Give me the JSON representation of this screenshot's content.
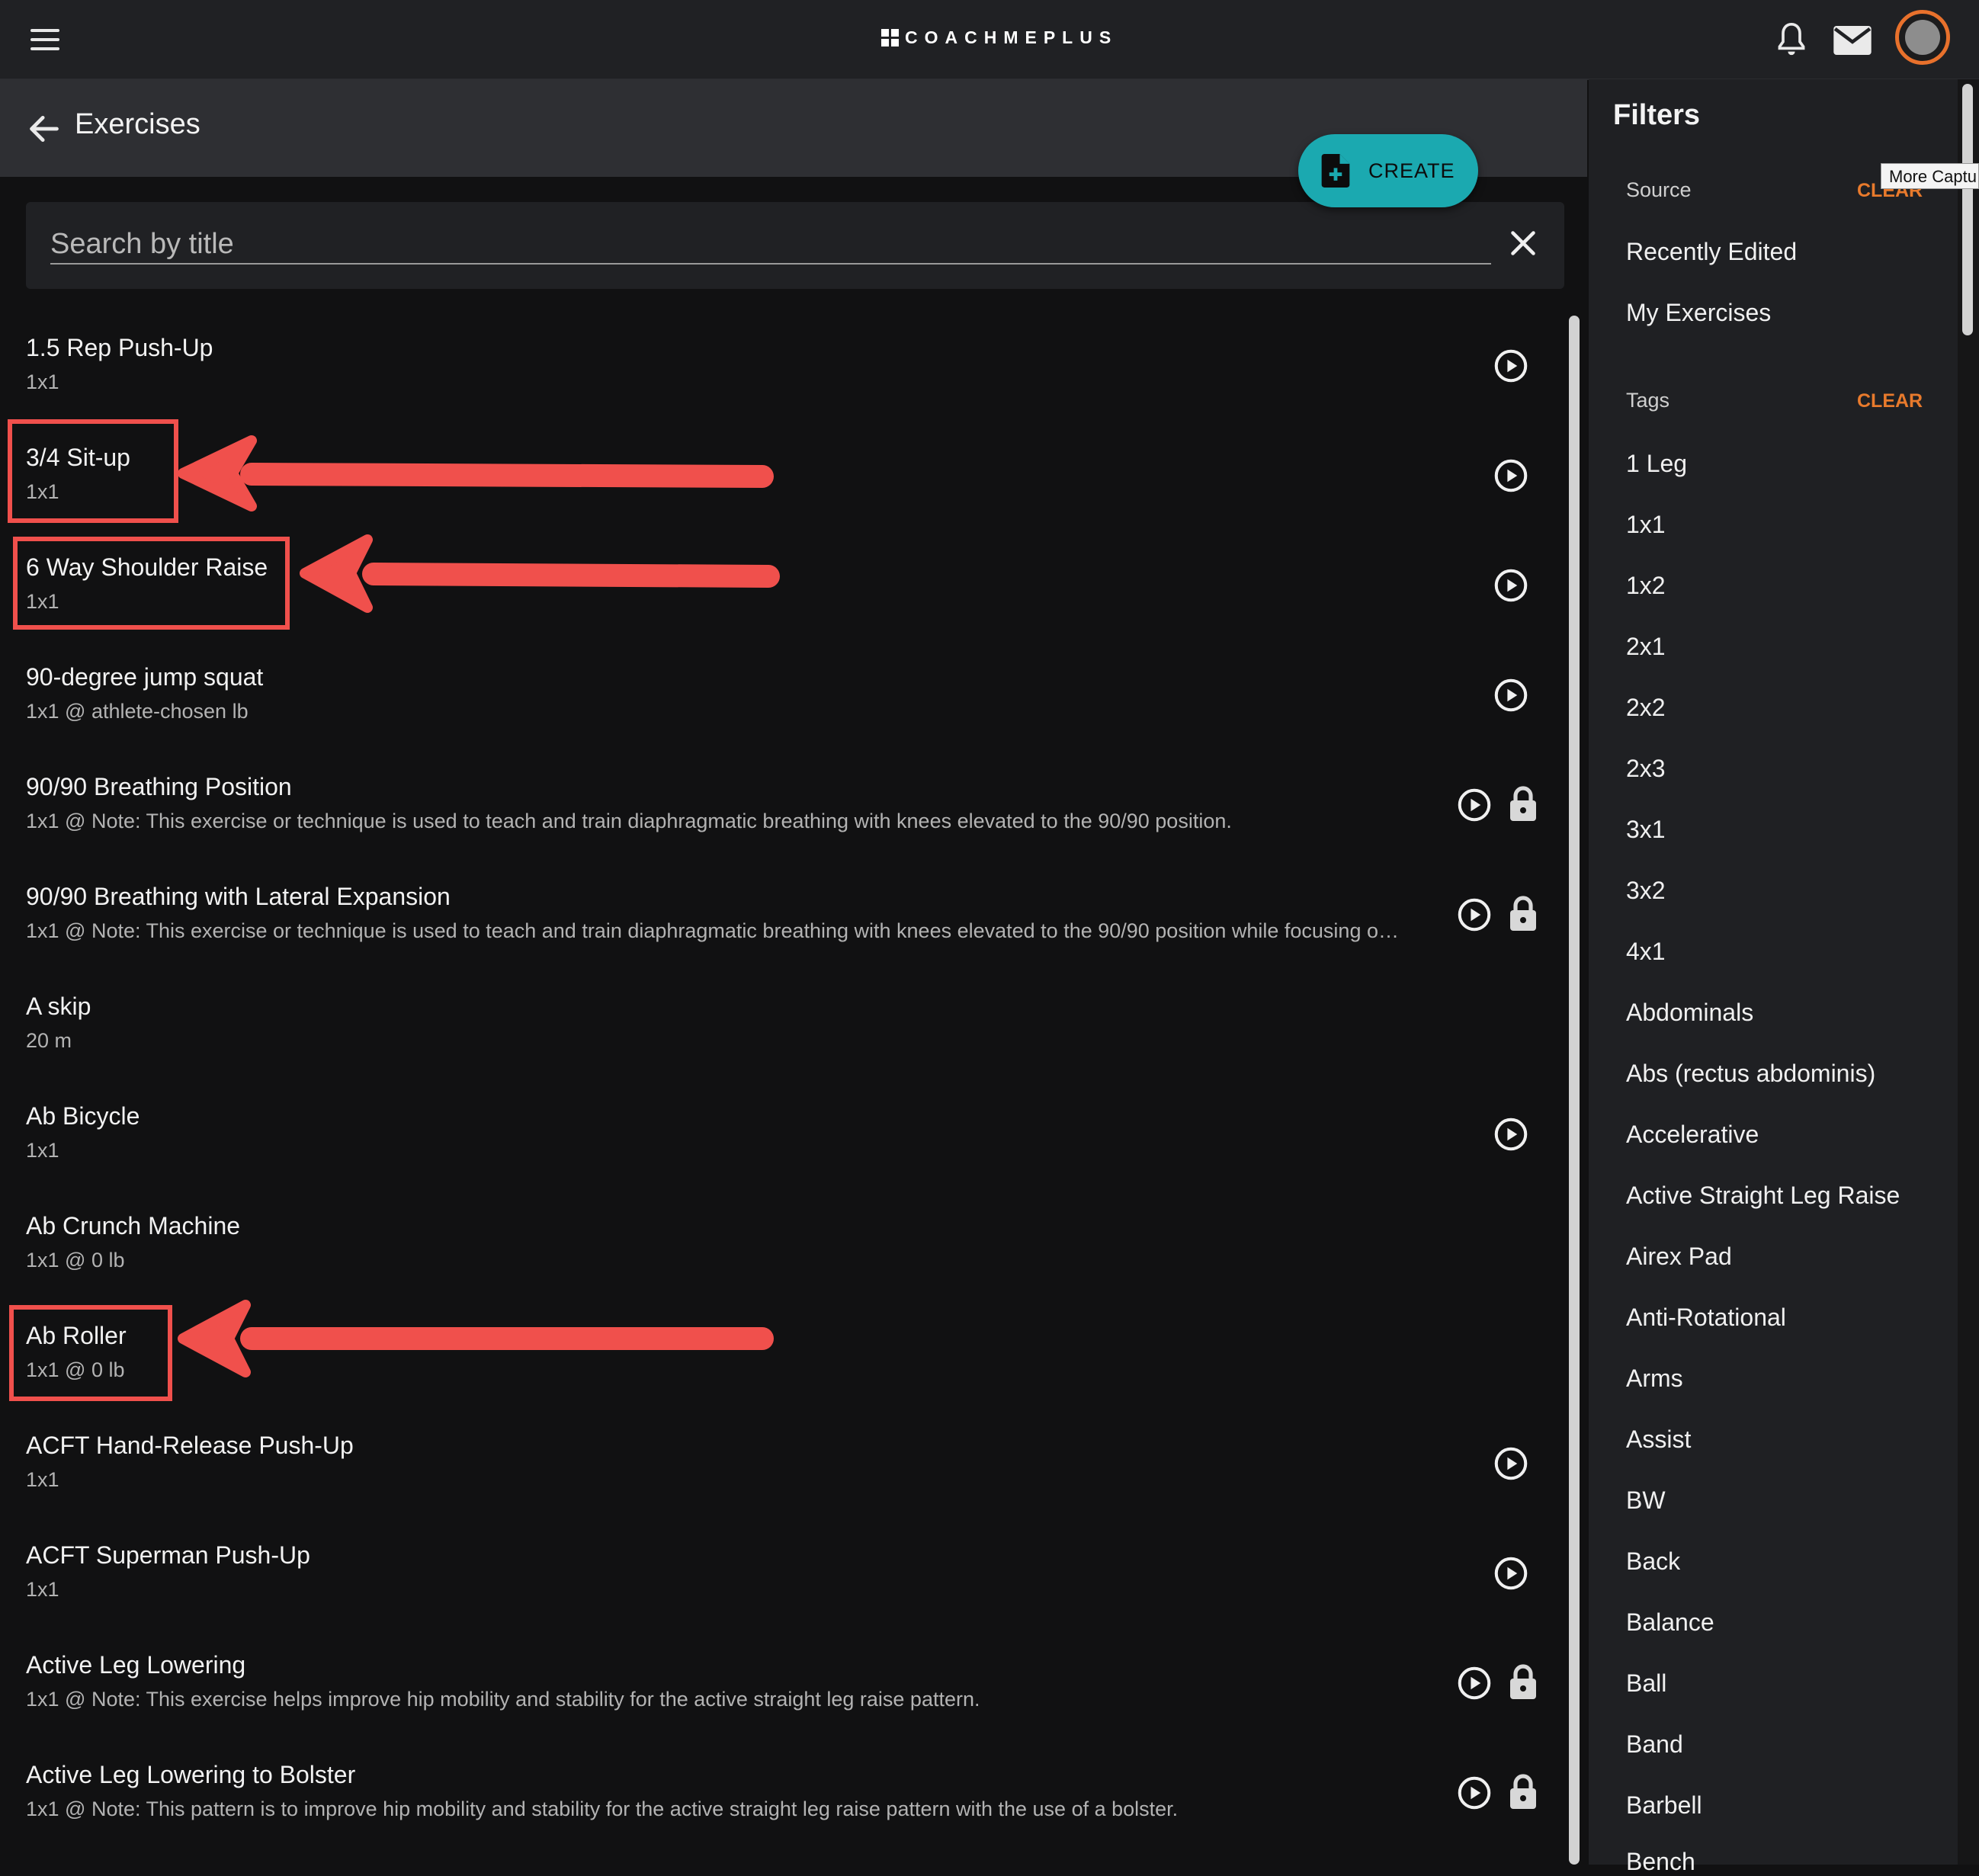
{
  "app": {
    "logo_text": "COACHMEPLUS"
  },
  "header": {
    "title": "Exercises",
    "create_label": "CREATE"
  },
  "search": {
    "placeholder": "Search by title",
    "value": ""
  },
  "exercises": [
    {
      "name": "1.5 Rep Push-Up",
      "detail": "1x1",
      "video": true,
      "locked": false
    },
    {
      "name": "3/4 Sit-up",
      "detail": "1x1",
      "video": true,
      "locked": false
    },
    {
      "name": "6 Way Shoulder Raise",
      "detail": "1x1",
      "video": true,
      "locked": false
    },
    {
      "name": "90-degree jump squat",
      "detail": "1x1 @ athlete-chosen lb",
      "video": true,
      "locked": false
    },
    {
      "name": "90/90 Breathing Position",
      "detail": "1x1 @ Note: This exercise or technique is used to teach and train diaphragmatic breathing with knees elevated to the 90/90 position.",
      "video": true,
      "locked": true
    },
    {
      "name": "90/90 Breathing with Lateral Expansion",
      "detail": "1x1 @ Note: This exercise or technique is used to teach and train diaphragmatic breathing with knees elevated to the 90/90 position while focusing o…",
      "video": true,
      "locked": true
    },
    {
      "name": "A skip",
      "detail": "20 m",
      "video": false,
      "locked": false
    },
    {
      "name": "Ab Bicycle",
      "detail": "1x1",
      "video": true,
      "locked": false
    },
    {
      "name": "Ab Crunch Machine",
      "detail": "1x1 @ 0 lb",
      "video": false,
      "locked": false
    },
    {
      "name": "Ab Roller",
      "detail": "1x1 @ 0 lb",
      "video": false,
      "locked": false
    },
    {
      "name": "ACFT Hand-Release Push-Up",
      "detail": "1x1",
      "video": true,
      "locked": false
    },
    {
      "name": "ACFT Superman Push-Up",
      "detail": "1x1",
      "video": true,
      "locked": false
    },
    {
      "name": "Active Leg Lowering",
      "detail": "1x1 @ Note: This exercise helps improve hip mobility and stability for the active straight leg raise pattern.",
      "video": true,
      "locked": true
    },
    {
      "name": "Active Leg Lowering to Bolster",
      "detail": "1x1 @ Note: This pattern is to improve hip mobility and stability for the active straight leg raise pattern with the use of a bolster.",
      "video": true,
      "locked": true
    }
  ],
  "filters": {
    "title": "Filters",
    "source_label": "Source",
    "source_clear": "CLEAR",
    "source_items": [
      "Recently Edited",
      "My Exercises"
    ],
    "tags_label": "Tags",
    "tags_clear": "CLEAR",
    "tags": [
      "1 Leg",
      "1x1",
      "1x2",
      "2x1",
      "2x2",
      "2x3",
      "3x1",
      "3x2",
      "4x1",
      "Abdominals",
      "Abs (rectus abdominis)",
      "Accelerative",
      "Active Straight Leg Raise",
      "Airex Pad",
      "Anti-Rotational",
      "Arms",
      "Assist",
      "BW",
      "Back",
      "Balance",
      "Ball",
      "Band",
      "Barbell",
      "Bench"
    ]
  },
  "tooltip": "More Captu",
  "colors": {
    "accent": "#1ba9b0",
    "clear_link": "#e87a2c",
    "annotation": "#f0504c",
    "avatar_ring": "#e8712c"
  }
}
